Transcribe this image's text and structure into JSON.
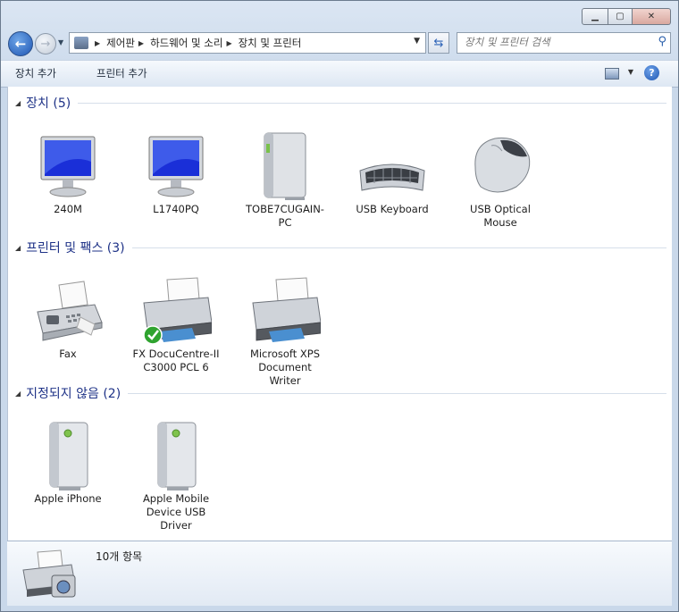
{
  "window": {
    "title_buttons": [
      "minimize",
      "maximize",
      "close"
    ]
  },
  "nav": {
    "breadcrumbs": [
      "제어판",
      "하드웨어 및 소리",
      "장치 및 프린터"
    ],
    "search_placeholder": "장치 및 프린터 검색"
  },
  "toolbar": {
    "add_device": "장치 추가",
    "add_printer": "프린터 추가"
  },
  "groups": [
    {
      "title": "장치 (5)",
      "items": [
        {
          "label": "240M",
          "icon": "monitor-icon"
        },
        {
          "label": "L1740PQ",
          "icon": "monitor-icon"
        },
        {
          "label": "TOBE7CUGAIN-PC",
          "icon": "computer-tower-icon"
        },
        {
          "label": "USB Keyboard",
          "icon": "keyboard-icon"
        },
        {
          "label": "USB Optical Mouse",
          "icon": "mouse-icon"
        }
      ]
    },
    {
      "title": "프린터 및 팩스 (3)",
      "items": [
        {
          "label": "Fax",
          "icon": "fax-icon"
        },
        {
          "label": "FX DocuCentre-II C3000 PCL 6",
          "icon": "printer-icon",
          "default": true
        },
        {
          "label": "Microsoft XPS Document Writer",
          "icon": "printer-icon"
        }
      ]
    },
    {
      "title": "지정되지 않음 (2)",
      "items": [
        {
          "label": "Apple iPhone",
          "icon": "storage-device-icon"
        },
        {
          "label": "Apple Mobile Device USB Driver",
          "icon": "storage-device-icon"
        }
      ]
    }
  ],
  "status": {
    "count": "10개 항목"
  }
}
